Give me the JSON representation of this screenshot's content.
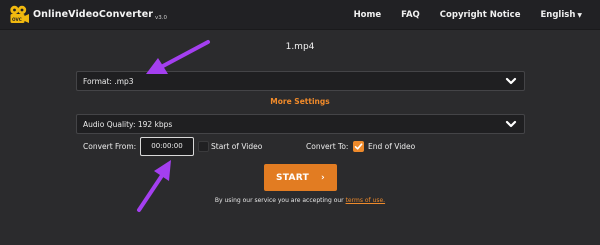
{
  "header": {
    "logo_brand": "OnlineVideoConverter",
    "logo_version": "v3.0",
    "nav": [
      {
        "label": "Home"
      },
      {
        "label": "FAQ"
      },
      {
        "label": "Copyright Notice"
      },
      {
        "label": "English"
      }
    ]
  },
  "main": {
    "filename": "1.mp4",
    "format_select": "Format: .mp3",
    "more_settings": "More Settings",
    "quality_select": "Audio Quality: 192 kbps",
    "convert_from_label": "Convert From:",
    "convert_from_value": "00:00:00",
    "start_of_video_label": "Start of Video",
    "start_of_video_checked": false,
    "convert_to_label": "Convert To:",
    "end_of_video_label": "End of Video",
    "end_of_video_checked": true,
    "start_button": "START",
    "terms_text": "By using our service you are accepting our",
    "terms_link": "terms of use."
  },
  "colors": {
    "background": "#2b2b2d",
    "navbar": "#212124",
    "accent": "#e27c22",
    "annotation_arrow": "#a43ff0"
  }
}
